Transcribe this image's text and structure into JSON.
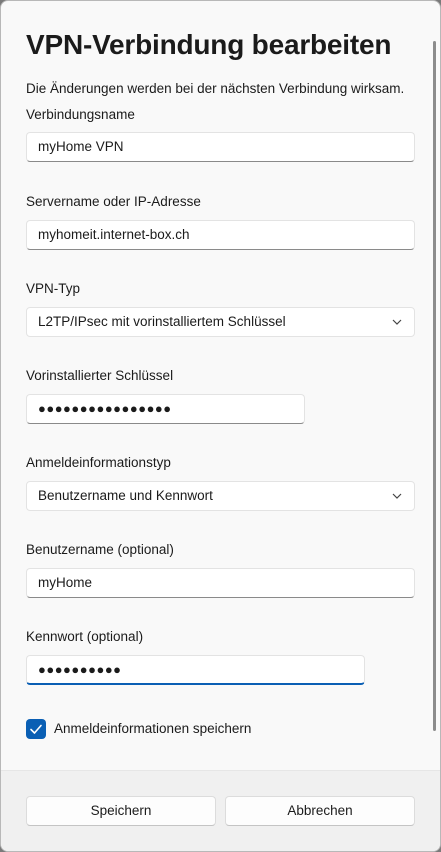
{
  "dialog": {
    "title": "VPN-Verbindung bearbeiten",
    "description": "Die Änderungen werden bei der nächsten Verbindung wirksam."
  },
  "fields": {
    "connection_name": {
      "label": "Verbindungsname",
      "value": "myHome VPN"
    },
    "server": {
      "label": "Servername oder IP-Adresse",
      "value": "myhomeit.internet-box.ch"
    },
    "vpn_type": {
      "label": "VPN-Typ",
      "value": "L2TP/IPsec mit vorinstalliertem Schlüssel"
    },
    "preshared_key": {
      "label": "Vorinstallierter Schlüssel",
      "value": "●●●●●●●●●●●●●●●●"
    },
    "credential_type": {
      "label": "Anmeldeinformationstyp",
      "value": "Benutzername und Kennwort"
    },
    "username": {
      "label": "Benutzername (optional)",
      "value": "myHome"
    },
    "password": {
      "label": "Kennwort (optional)",
      "value": "●●●●●●●●●●"
    }
  },
  "remember": {
    "label": "Anmeldeinformationen speichern",
    "checked": true
  },
  "buttons": {
    "save": "Speichern",
    "cancel": "Abbrechen"
  },
  "colors": {
    "accent": "#0a5fb4"
  },
  "icons": {
    "chevron": "chevron-down-icon",
    "check": "checkmark-icon"
  }
}
